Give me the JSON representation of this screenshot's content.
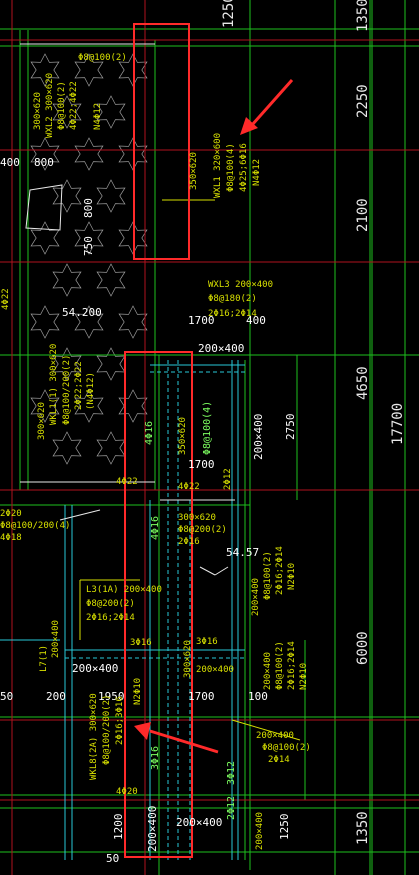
{
  "colors": {
    "background": "#000000",
    "grid_green": "#1ebf1e",
    "axis_red": "#b0121e",
    "cyan": "#28c8d8",
    "beam_yellow": "#d8e000",
    "white": "#e8e8e8",
    "highlight_red": "#ff2a2a"
  },
  "right_dimensions": {
    "top": "1250",
    "seg1": "1350",
    "seg2": "2250",
    "seg3": "2100",
    "seg4": "4650",
    "total": "17700",
    "seg5": "6000",
    "seg6": "1350"
  },
  "annotations": {
    "top_stirrup": "Φ8@100(2)",
    "wxl2_head": "300×620",
    "wxl2_name": "WXL2 300×620",
    "wxl2_stirrup": "Φ8@100(2)",
    "wxl2_bars": "4Φ22;4Φ22",
    "wxl2_n": "N4Φ12",
    "dim_800a": "800",
    "dim_800b": "800",
    "dim_400": "400",
    "dim_750": "750",
    "side_4022": "4Φ22",
    "vert_beam": "350×620",
    "wxl1_name": "WXL1 320×600",
    "wxl1_stirrup": "Φ8@100(4)",
    "wxl1_bars": "4Φ25;6Φ16",
    "wxl1_n": "N4Φ12",
    "wxl3_name": "WXL3 200×400",
    "wxl3_stirrup": "Φ8@180(2)",
    "wxl3_bars": "2Φ16;2Φ14",
    "elev": "54.200",
    "dim_1700a": "1700",
    "dim_400b": "400",
    "beam_200x400a": "200×400",
    "wkl1_size": "300×620",
    "wkl1_name": "WKL1(1) 300×620",
    "wkl1_stirrup": "Φ8@100/200(2)",
    "wkl1_bars": "2Φ22;2Φ22",
    "wkl1_n": "(N4Φ12)",
    "vert_350": "350×620",
    "vert_stir": "Φ8@100(4)",
    "v_4016": "4Φ16",
    "dim_2750": "2750",
    "beam_200x400b": "200×400",
    "dim_1700b": "1700",
    "bar_4022a": "4Φ22",
    "bar_4022b": "4Φ22",
    "bar_2012": "2Φ12",
    "left_1": "2Φ20",
    "left_2": "Φ8@100/200(4)",
    "left_3": "4Φ18",
    "beam_300x620": "300×620",
    "beam_phi8": "Φ8@200(2)",
    "beam_phi16": "2Φ16",
    "v_4016b": "4Φ16",
    "elev2": "54.57",
    "l3_name": "L3(1A) 200×400",
    "l3_stirrup": "Φ8@200(2)",
    "l3_bars": "2Φ16;2Φ14",
    "r_200x400": "200×400",
    "r_phi8": "Φ8@100(2)",
    "r_2014": "2Φ16;2Φ14",
    "r_n": "N2Φ10",
    "l7": "L7(1)",
    "l7_200x400": "200×400",
    "dim_3016a": "3Φ16",
    "dim_3016b": "3Φ16",
    "beam_200x400c": "200×400",
    "beam_300x620b": "300×620",
    "beam_200x400d": "200×400",
    "dim_50": "50",
    "dim_200": "200",
    "dim_1950": "1950",
    "dim_1700c": "1700",
    "dim_100": "100",
    "n2010": "N2Φ10",
    "r2_200x400": "200×400",
    "r2_stir": "Φ8@100(2)",
    "r2_bars": "2Φ16;2Φ14",
    "r2_n": "N2Φ10",
    "wkl8_name": "WKL8(2A) 300×620",
    "wkl8_stirrup": "Φ8@100/200(2)",
    "wkl8_bars": "2Φ16;3Φ16",
    "r3_200x400": "200×400",
    "r3_stir": "Φ8@100(2)",
    "r3_2014": "2Φ14",
    "v_3016": "3Φ16",
    "v_4020": "4Φ20",
    "v_3012": "3Φ12",
    "v_2012": "2Φ12",
    "dim_1200": "1200",
    "dim_50b": "50",
    "beam_200x400e": "200×400",
    "beam_200x400f": "200×400",
    "beam_200x400g": "200×400",
    "dim_1250b": "1250"
  }
}
